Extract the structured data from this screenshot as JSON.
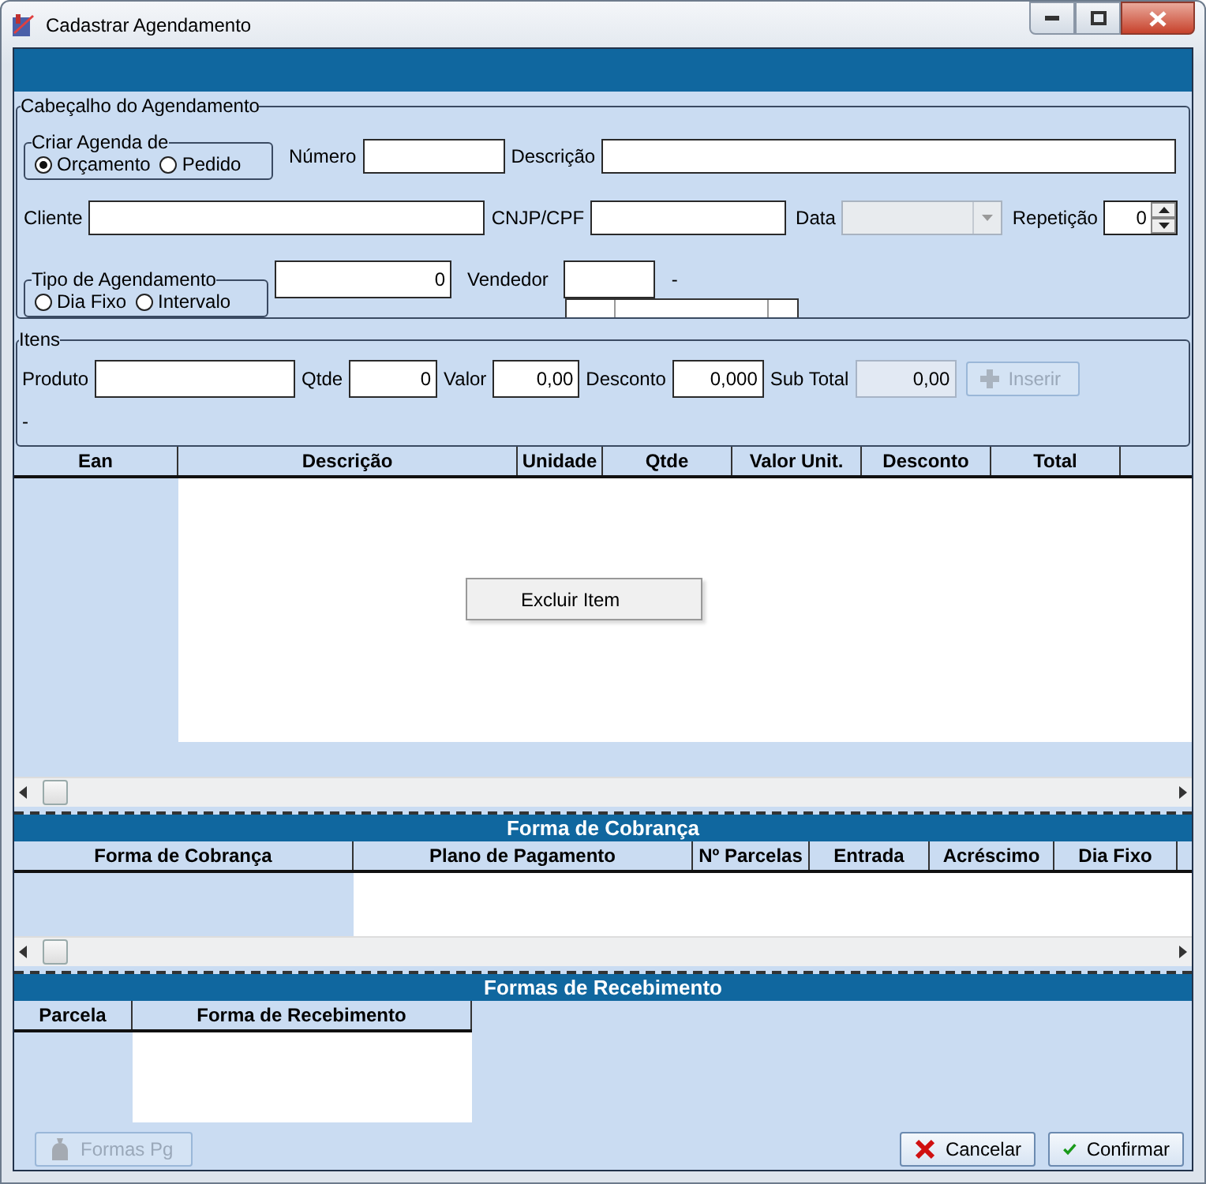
{
  "window": {
    "title": "Cadastrar Agendamento"
  },
  "header": {
    "title": "Cabeçalho do Agendamento",
    "create_from": {
      "title": "Criar Agenda de",
      "options": [
        {
          "label": "Orçamento",
          "selected": true
        },
        {
          "label": "Pedido",
          "selected": false
        }
      ]
    },
    "numero": {
      "label": "Número"
    },
    "descricao": {
      "label": "Descrição"
    },
    "cliente": {
      "label": "Cliente"
    },
    "cpf": {
      "label": "CNJP/CPF"
    },
    "data": {
      "label": "Data",
      "disabled": true
    },
    "repeticao": {
      "label": "Repetição",
      "value": "0"
    },
    "tipo": {
      "title": "Tipo de Agendamento",
      "options": [
        {
          "label": "Dia Fixo",
          "selected": false
        },
        {
          "label": "Intervalo",
          "selected": false
        }
      ]
    },
    "intervalo_value": "0",
    "vendedor": {
      "label": "Vendedor",
      "name": "-"
    }
  },
  "itens": {
    "title": "Itens",
    "fields": [
      {
        "label": "Produto",
        "disabled": false
      },
      {
        "label": "Qtde",
        "value": "0",
        "disabled": false
      },
      {
        "label": "Valor",
        "value": "0,00",
        "disabled": false
      },
      {
        "label": "Desconto",
        "value": "0,000",
        "disabled": false
      },
      {
        "label": "Sub Total",
        "value": "0,00",
        "disabled": true
      }
    ],
    "insert_button": {
      "label": "Inserir",
      "disabled": true
    },
    "product_description": "-",
    "table": {
      "columns": [
        "Ean",
        "Descrição",
        "Unidade",
        "Qtde",
        "Valor Unit.",
        "Desconto",
        "Total"
      ]
    },
    "context_menu": {
      "items": [
        "Excluir Item"
      ]
    }
  },
  "cobranca": {
    "title": "Forma de Cobrança",
    "columns": [
      "Forma de Cobrança",
      "Plano de Pagamento",
      "Nº Parcelas",
      "Entrada",
      "Acréscimo",
      "Dia Fixo"
    ]
  },
  "recebimento": {
    "title": "Formas de Recebimento",
    "columns": [
      "Parcela",
      "Forma de Recebimento"
    ]
  },
  "buttons": [
    {
      "kind": "formas",
      "label": "Formas Pg",
      "disabled": true
    },
    {
      "kind": "cancel",
      "label": "Cancelar",
      "disabled": false
    },
    {
      "kind": "confirm",
      "label": "Confirmar",
      "disabled": false
    }
  ]
}
